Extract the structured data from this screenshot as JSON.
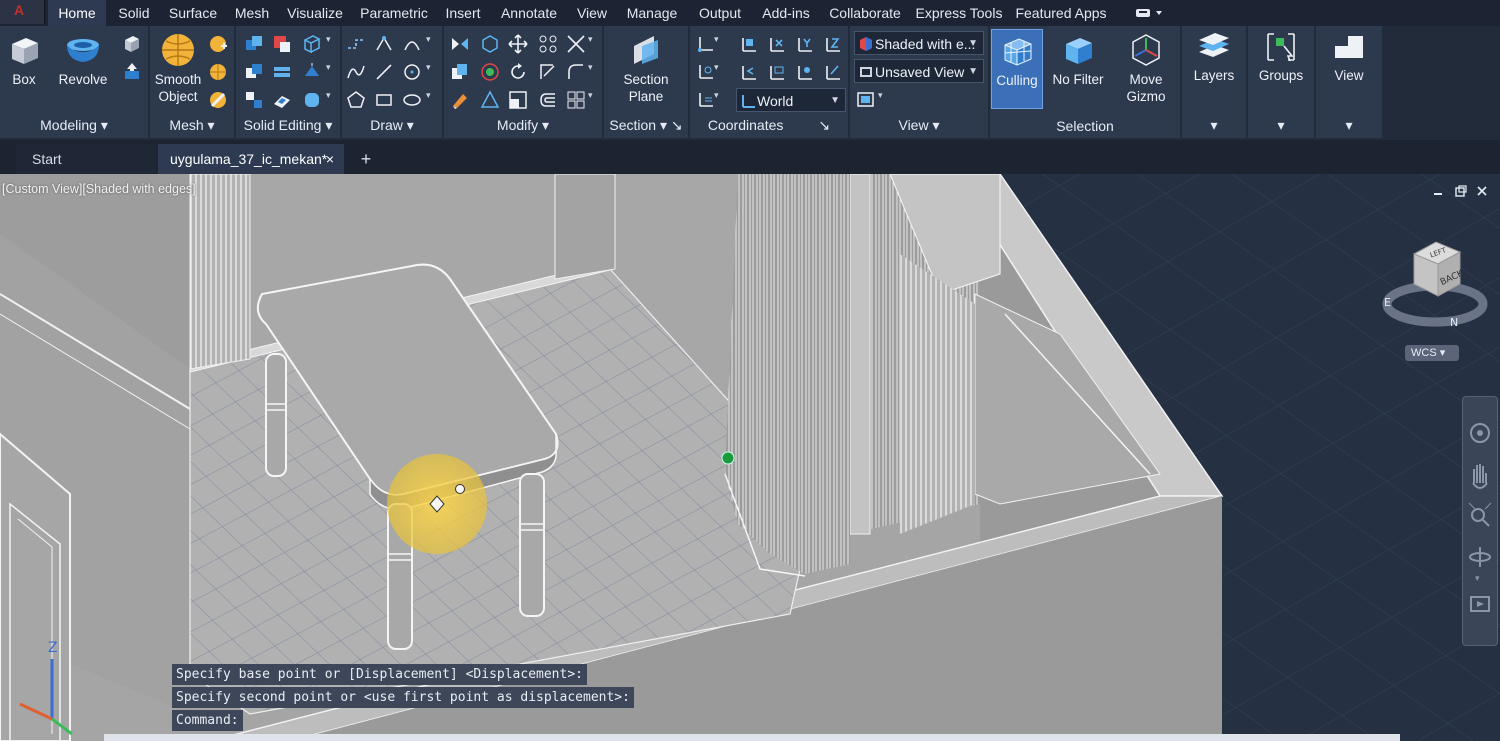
{
  "menu": {
    "tabs": [
      "Home",
      "Solid",
      "Surface",
      "Mesh",
      "Visualize",
      "Parametric",
      "Insert",
      "Annotate",
      "View",
      "Manage",
      "Output",
      "Add-ins",
      "Collaborate",
      "Express Tools",
      "Featured Apps"
    ],
    "active_tab": "Home"
  },
  "ribbon": {
    "modeling": {
      "title": "Modeling",
      "box": "Box",
      "revolve": "Revolve"
    },
    "mesh": {
      "title": "Mesh",
      "smooth_line1": "Smooth",
      "smooth_line2": "Object"
    },
    "solid_editing": {
      "title": "Solid Editing"
    },
    "draw": {
      "title": "Draw"
    },
    "modify": {
      "title": "Modify"
    },
    "section": {
      "title": "Section",
      "plane_line1": "Section",
      "plane_line2": "Plane"
    },
    "coordinates": {
      "title": "Coordinates",
      "ucs_combo": "World"
    },
    "view": {
      "title": "View",
      "visual_style": "Shaded with e...",
      "named_view": "Unsaved View"
    },
    "selection": {
      "title": "Selection",
      "culling": "Culling",
      "no_filter": "No Filter",
      "move_line1": "Move",
      "move_line2": "Gizmo"
    },
    "layers": "Layers",
    "groups": "Groups",
    "view_big": "View"
  },
  "doc_tabs": {
    "start": "Start",
    "active": "uygulama_37_ic_mekan*",
    "close": "×",
    "add": "+"
  },
  "viewport": {
    "label": "[Custom View][Shaded with edges]",
    "viewcube_face": "BACK",
    "viewcube_top": "LEFT",
    "compass_e": "E",
    "compass_n": "N",
    "wcs": "WCS",
    "ucs_z": "Z"
  },
  "command_history": [
    "Specify base point or [Displacement] <Displacement>:",
    "Specify second point or <use first point as displacement>:",
    "Command:"
  ],
  "colors": {
    "accent": "#3f7fd6",
    "active_tab": "#2d3a52",
    "highlight": "#ffd84a"
  }
}
